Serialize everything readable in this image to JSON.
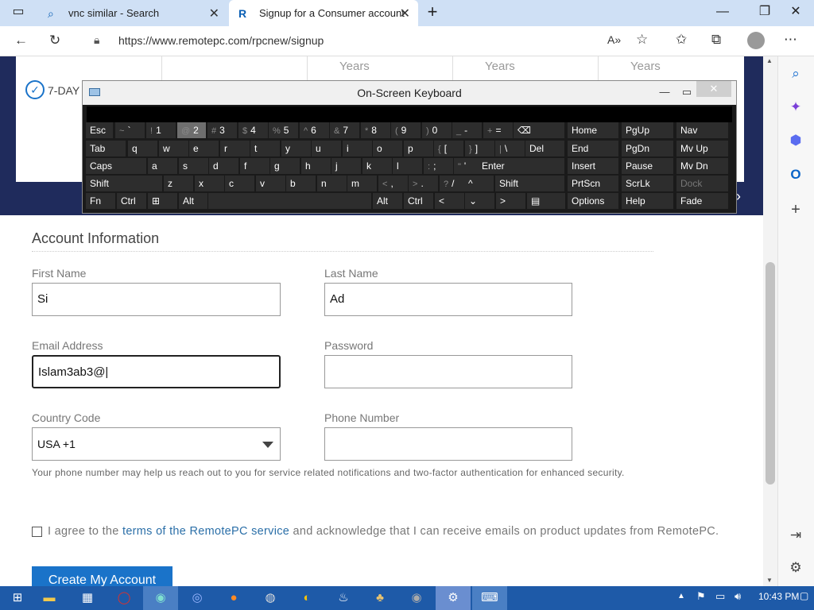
{
  "browser": {
    "tabs": [
      {
        "label": "vnc similar - Search",
        "icon": "search-icon"
      },
      {
        "label": "Signup for a Consumer account",
        "icon": "remotepc-icon"
      }
    ],
    "url": "https://www.remotepc.com/rpcnew/signup"
  },
  "page": {
    "years": [
      "Years",
      "Years",
      "Years"
    ],
    "trial_label": "7-DAY",
    "section_title": "Account Information",
    "first_name_label": "First Name",
    "first_name_value": "Si",
    "last_name_label": "Last Name",
    "last_name_value": "Ad",
    "email_label": "Email Address",
    "email_value": "Islam3ab3@|",
    "password_label": "Password",
    "password_value": "",
    "country_label": "Country Code",
    "country_value": "USA +1",
    "phone_label": "Phone Number",
    "phone_value": "",
    "phone_hint": "Your phone number may help us reach out to you for service related notifications and two-factor authentication for enhanced security.",
    "agree_prefix": "I agree to the ",
    "agree_link": "terms of the RemotePC service",
    "agree_suffix": " and acknowledge that I can receive emails on product updates from RemotePC.",
    "create_button": "Create My Account"
  },
  "osk": {
    "title": "On-Screen Keyboard",
    "rows": [
      [
        [
          "Esc",
          ""
        ],
        [
          "~",
          "`"
        ],
        [
          "!",
          "1"
        ],
        [
          "@",
          "2"
        ],
        [
          "#",
          "3"
        ],
        [
          "$",
          "4"
        ],
        [
          "%",
          "5"
        ],
        [
          "^",
          "6"
        ],
        [
          "&",
          "7"
        ],
        [
          "*",
          "8"
        ],
        [
          "(",
          "9"
        ],
        [
          ")",
          "0"
        ],
        [
          "_",
          "-"
        ],
        [
          "+",
          "="
        ],
        [
          "",
          "⌫"
        ]
      ],
      [
        [
          "Tab",
          ""
        ],
        [
          "",
          "q"
        ],
        [
          "",
          "w"
        ],
        [
          "",
          "e"
        ],
        [
          "",
          "r"
        ],
        [
          "",
          "t"
        ],
        [
          "",
          "y"
        ],
        [
          "",
          "u"
        ],
        [
          "",
          "i"
        ],
        [
          "",
          "o"
        ],
        [
          "",
          "p"
        ],
        [
          "{",
          "["
        ],
        [
          "}",
          "]"
        ],
        [
          "|",
          "\\"
        ],
        [
          "Del",
          ""
        ]
      ],
      [
        [
          "Caps",
          ""
        ],
        [
          "",
          "a"
        ],
        [
          "",
          "s"
        ],
        [
          "",
          "d"
        ],
        [
          "",
          "f"
        ],
        [
          "",
          "g"
        ],
        [
          "",
          "h"
        ],
        [
          "",
          "j"
        ],
        [
          "",
          "k"
        ],
        [
          "",
          "l"
        ],
        [
          ":",
          ";"
        ],
        [
          "\"",
          "'"
        ],
        [
          "Enter",
          ""
        ]
      ],
      [
        [
          "Shift",
          ""
        ],
        [
          "",
          "z"
        ],
        [
          "",
          "x"
        ],
        [
          "",
          "c"
        ],
        [
          "",
          "v"
        ],
        [
          "",
          "b"
        ],
        [
          "",
          "n"
        ],
        [
          "",
          "m"
        ],
        [
          "<",
          ","
        ],
        [
          ">",
          "."
        ],
        [
          "?",
          "/"
        ],
        [
          "",
          "^"
        ],
        [
          "Shift",
          ""
        ]
      ],
      [
        [
          "Fn",
          ""
        ],
        [
          "Ctrl",
          ""
        ],
        [
          "",
          "⊞"
        ],
        [
          "Alt",
          ""
        ],
        [
          "",
          ""
        ],
        [
          "Alt",
          ""
        ],
        [
          "Ctrl",
          ""
        ],
        [
          "",
          "<"
        ],
        [
          "",
          "⌄"
        ],
        [
          "",
          ">"
        ],
        [
          "",
          "▤"
        ]
      ]
    ],
    "nav_rows": [
      [
        "Home",
        "PgUp",
        "Nav"
      ],
      [
        "End",
        "PgDn",
        "Mv Up"
      ],
      [
        "Insert",
        "Pause",
        "Mv Dn"
      ],
      [
        "PrtScn",
        "ScrLk",
        "Dock"
      ],
      [
        "Options",
        "Help",
        "Fade"
      ]
    ]
  },
  "taskbar": {
    "clock": "10:43 PM"
  }
}
